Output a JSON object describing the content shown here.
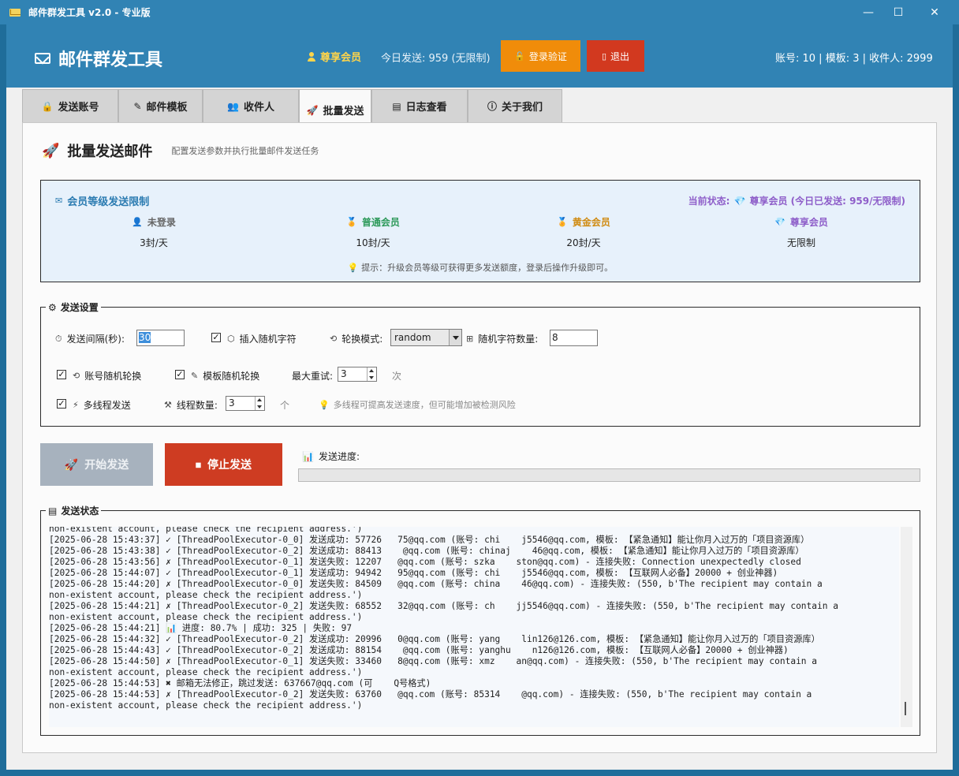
{
  "window": {
    "title": "邮件群发工具 v2.0 - 专业版",
    "min_icon": "minimize-icon",
    "max_icon": "maximize-icon",
    "close_icon": "close-icon"
  },
  "header": {
    "brand": "邮件群发工具",
    "vip_label": "尊享会员",
    "today_sent": "今日发送: 959 (无限制)",
    "login_button": "登录验证",
    "logout_button": "退出",
    "stats": "账号: 10 | 模板: 3 | 收件人: 2999",
    "colors": {
      "header_bg": "#3183b4",
      "login_bg": "#f08c0a",
      "logout_bg": "#d2391f",
      "vip": "#ffd54a"
    }
  },
  "tabs": [
    {
      "label": "发送账号",
      "icon": "lock-icon"
    },
    {
      "label": "邮件模板",
      "icon": "edit-icon"
    },
    {
      "label": "收件人",
      "icon": "users-icon"
    },
    {
      "label": "批量发送",
      "icon": "rocket-icon",
      "active": true
    },
    {
      "label": "日志查看",
      "icon": "log-icon"
    },
    {
      "label": "关于我们",
      "icon": "info-icon"
    }
  ],
  "page": {
    "title": "批量发送邮件",
    "subtitle": "配置发送参数并执行批量邮件发送任务"
  },
  "membership": {
    "title": "会员等级发送限制",
    "current_label": "当前状态:",
    "current_value": "尊享会员 (今日已发送: 959/无限制)",
    "tiers": [
      {
        "name": "未登录",
        "quota": "3封/天",
        "icon": "user-icon",
        "color": "#666666"
      },
      {
        "name": "普通会员",
        "quota": "10封/天",
        "icon": "medal-icon",
        "color": "#2e9a5b"
      },
      {
        "name": "黄金会员",
        "quota": "20封/天",
        "icon": "medal-icon",
        "color": "#d08b12"
      },
      {
        "name": "尊享会员",
        "quota": "无限制",
        "icon": "diamond-icon",
        "color": "#8e5ec9"
      }
    ],
    "tip": "提示：升级会员等级可获得更多发送额度，登录后操作升级即可。"
  },
  "settings": {
    "legend": "发送设置",
    "interval_label": "发送间隔(秒):",
    "interval_value": "30",
    "random_chars_label": "插入随机字符",
    "random_chars_checked": true,
    "rotation_mode_label": "轮换模式:",
    "rotation_mode_value": "random",
    "random_char_count_label": "随机字符数量:",
    "random_char_count_value": "8",
    "account_rotation_label": "账号随机轮换",
    "account_rotation_checked": true,
    "template_rotation_label": "模板随机轮换",
    "template_rotation_checked": true,
    "max_retry_label": "最大重试:",
    "max_retry_value": "3",
    "max_retry_unit": "次",
    "multithread_label": "多线程发送",
    "multithread_checked": true,
    "thread_count_label": "线程数量:",
    "thread_count_value": "3",
    "thread_count_unit": "个",
    "multithread_hint": "多线程可提高发送速度，但可能增加被检测风险"
  },
  "actions": {
    "start_button": "开始发送",
    "stop_button": "停止发送",
    "progress_label": "发送进度:",
    "progress_fraction": 0
  },
  "log": {
    "legend": "发送状态",
    "lines": [
      "non-existent account, please check the recipient address.')",
      "[2025-06-28 15:43:37] ✓ [ThreadPoolExecutor-0_0] 发送成功: 57726   75@qq.com (账号: chi    j5546@qq.com, 模板: 【紧急通知】能让你月入过万的「项目资源库）",
      "[2025-06-28 15:43:38] ✓ [ThreadPoolExecutor-0_2] 发送成功: 88413    @qq.com (账号: chinaj    46@qq.com, 模板: 【紧急通知】能让你月入过万的「项目资源库）",
      "[2025-06-28 15:43:56] ✗ [ThreadPoolExecutor-0_1] 发送失败: 12207   @qq.com (账号: szka    ston@qq.com) - 连接失败: Connection unexpectedly closed",
      "[2025-06-28 15:44:07] ✓ [ThreadPoolExecutor-0_1] 发送成功: 94942   95@qq.com (账号: chi    j5546@qq.com, 模板: 【互联网人必备】20000 + 创业神器)",
      "[2025-06-28 15:44:20] ✗ [ThreadPoolExecutor-0_0] 发送失败: 84509   @qq.com (账号: china    46@qq.com) - 连接失败: (550, b'The recipient may contain a",
      "non-existent account, please check the recipient address.')",
      "[2025-06-28 15:44:21] ✗ [ThreadPoolExecutor-0_2] 发送失败: 68552   32@qq.com (账号: ch    jj5546@qq.com) - 连接失败: (550, b'The recipient may contain a",
      "non-existent account, please check the recipient address.')",
      "[2025-06-28 15:44:21] 📊 进度: 80.7% | 成功: 325 | 失败: 97",
      "[2025-06-28 15:44:32] ✓ [ThreadPoolExecutor-0_2] 发送成功: 20996   0@qq.com (账号: yang    lin126@126.com, 模板: 【紧急通知】能让你月入过万的「项目资源库）",
      "[2025-06-28 15:44:43] ✓ [ThreadPoolExecutor-0_2] 发送成功: 88154    @qq.com (账号: yanghu    n126@126.com, 模板: 【互联网人必备】20000 + 创业神器)",
      "[2025-06-28 15:44:50] ✗ [ThreadPoolExecutor-0_1] 发送失败: 33460   8@qq.com (账号: xmz    an@qq.com) - 连接失败: (550, b'The recipient may contain a",
      "non-existent account, please check the recipient address.')",
      "[2025-06-28 15:44:53] ✖ 邮箱无法修正，跳过发送: 637667@qq.com (可    Q号格式)",
      "[2025-06-28 15:44:53] ✗ [ThreadPoolExecutor-0_2] 发送失败: 63760   @qq.com (账号: 85314    @qq.com) - 连接失败: (550, b'The recipient may contain a",
      "non-existent account, please check the recipient address.')"
    ]
  }
}
